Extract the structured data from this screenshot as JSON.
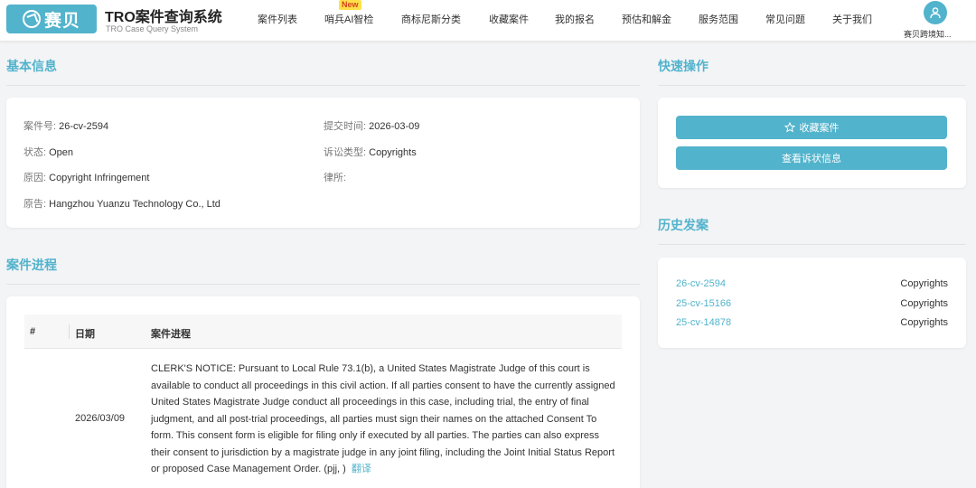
{
  "brand": {
    "logo_text": "赛贝",
    "title": "TRO案件查询系统",
    "subtitle": "TRO Case Query System"
  },
  "nav": {
    "items": [
      {
        "label": "案件列表"
      },
      {
        "label": "哨兵AI智检",
        "badge": "New"
      },
      {
        "label": "商标尼斯分类"
      },
      {
        "label": "收藏案件"
      },
      {
        "label": "我的报名"
      },
      {
        "label": "预估和解金"
      },
      {
        "label": "服务范围"
      },
      {
        "label": "常见问题"
      },
      {
        "label": "关于我们"
      }
    ],
    "user_name": "赛贝跨境知..."
  },
  "basic_info": {
    "title": "基本信息",
    "case_no_label": "案件号:",
    "case_no": "26-cv-2594",
    "filed_label": "提交时间:",
    "filed": "2026-03-09",
    "status_label": "状态:",
    "status": "Open",
    "type_label": "诉讼类型:",
    "type": "Copyrights",
    "cause_label": "原因:",
    "cause": "Copyright Infringement",
    "firm_label": "律所:",
    "firm": "",
    "plaintiff_label": "原告:",
    "plaintiff": "Hangzhou Yuanzu Technology Co., Ltd"
  },
  "progress": {
    "title": "案件进程",
    "columns": [
      "#",
      "日期",
      "案件进程"
    ],
    "rows": [
      {
        "date": "2026/03/09",
        "text": "CLERK'S NOTICE: Pursuant to Local Rule 73.1(b), a United States Magistrate Judge of this court is available to conduct all proceedings in this civil action. If all parties consent to have the currently assigned United States Magistrate Judge conduct all proceedings in this case, including trial, the entry of final judgment, and all post-trial proceedings, all parties must sign their names on the attached Consent To form. This consent form is eligible for filing only if executed by all parties. The parties can also express their consent to jurisdiction by a magistrate judge in any joint filing, including the Joint Initial Status Report or proposed Case Management Order. (pjj, )",
        "translate": "翻译"
      }
    ]
  },
  "quick_actions": {
    "title": "快速操作",
    "favorite_label": "收藏案件",
    "complaint_label": "查看诉状信息"
  },
  "history": {
    "title": "历史发案",
    "items": [
      {
        "case": "26-cv-2594",
        "type": "Copyrights"
      },
      {
        "case": "25-cv-15166",
        "type": "Copyrights"
      },
      {
        "case": "25-cv-14878",
        "type": "Copyrights"
      }
    ]
  },
  "colors": {
    "accent": "#52b3cc",
    "badge_bg": "#ffe04a",
    "badge_text": "#d4411f",
    "background": "#f3f4f6"
  },
  "icons": {
    "logo": "logo-mark-icon",
    "user": "user-icon",
    "favorite": "star-icon"
  }
}
